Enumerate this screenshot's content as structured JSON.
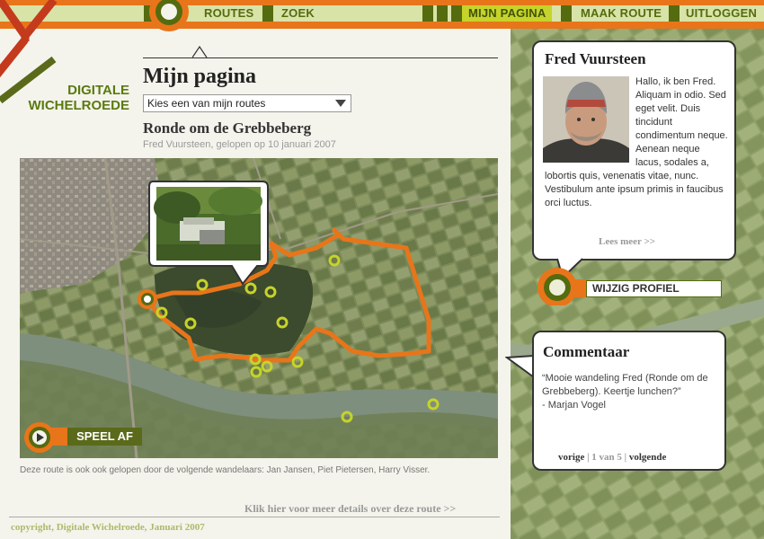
{
  "nav": {
    "routes": "ROUTES",
    "zoek": "ZOEK",
    "mijn_pagina": "MIJN PAGINA",
    "maak_route": "MAAK ROUTE",
    "uitloggen": "UITLOGGEN"
  },
  "logo": {
    "line1": "DIGITALE",
    "line2": "WICHELROEDE"
  },
  "page": {
    "title": "Mijn pagina",
    "route_select": "Kies een van mijn routes",
    "route_title": "Ronde om de Grebbeberg",
    "route_meta": "Fred Vuursteen, gelopen op 10 januari 2007"
  },
  "map": {
    "play_label": "SPEEL AF",
    "walkers": "Deze route is ook ook gelopen door de volgende wandelaars: Jan Jansen, Piet Pietersen, Harry Visser.",
    "details_link": "Klik hier voor meer details over deze route >>"
  },
  "footer": {
    "copyright": "copyright, Digitale Wichelroede, Januari 2007"
  },
  "profile": {
    "name": "Fred Vuursteen",
    "bio": "Hallo, ik ben Fred. Aliquam in odio. Sed eget velit. Duis tincidunt condimentum neque. Aenean neque lacus, sodales a, lobortis quis, venenatis vitae, nunc. Vestibulum ante ipsum primis in faucibus orci luctus.",
    "more": "Lees meer >>",
    "edit": "WIJZIG PROFIEL"
  },
  "comment": {
    "title": "Commentaar",
    "text": "“Mooie wandeling Fred (Ronde om de Grebbeberg). Keertje lunchen?”",
    "author": "- Marjan Vogel",
    "prev": "vorige",
    "page": "1 van 5",
    "next": "volgende"
  },
  "colors": {
    "orange": "#e8751a",
    "olive": "#556b10",
    "lime": "#c6d32a",
    "red": "#c43a1d"
  }
}
